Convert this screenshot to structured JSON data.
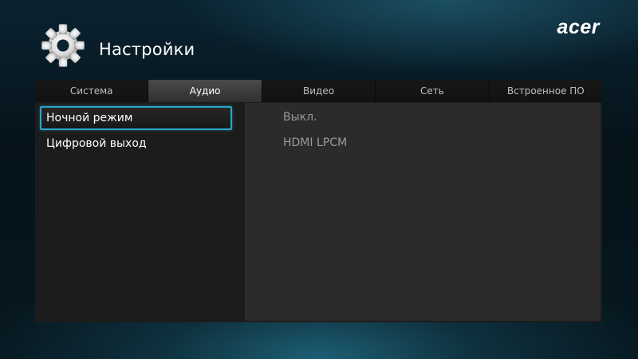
{
  "header": {
    "title": "Настройки",
    "icon": "gear-icon",
    "brand": "acer"
  },
  "tabs": [
    {
      "label": "Система",
      "active": false
    },
    {
      "label": "Аудио",
      "active": true
    },
    {
      "label": "Видео",
      "active": false
    },
    {
      "label": "Сеть",
      "active": false
    },
    {
      "label": "Встроенное ПО",
      "active": false
    }
  ],
  "settings": [
    {
      "label": "Ночной режим",
      "value": "Выкл.",
      "selected": true
    },
    {
      "label": "Цифровой выход",
      "value": "HDMI LPCM",
      "selected": false
    }
  ],
  "colors": {
    "accent": "#2aa6c9",
    "value_text": "#9a9a9a"
  }
}
